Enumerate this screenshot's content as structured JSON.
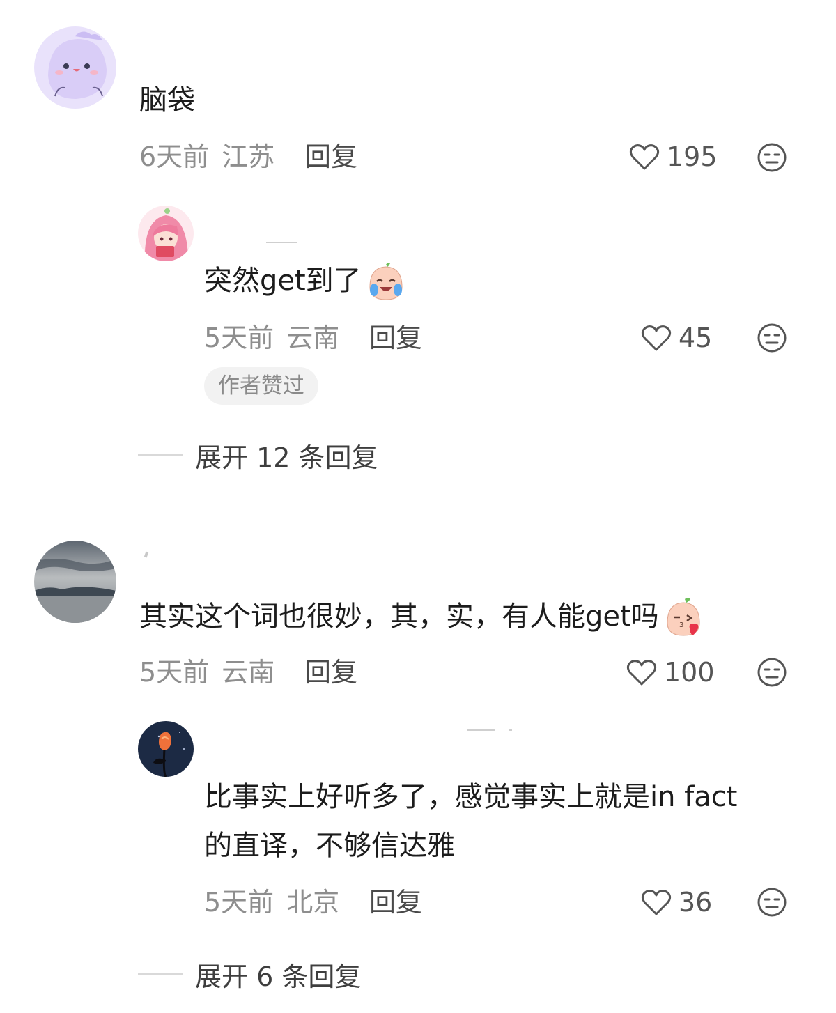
{
  "comments": [
    {
      "text": "脑袋",
      "time": "6天前",
      "location": "江苏",
      "reply_label": "回复",
      "likes": "195",
      "avatar": "purple-cartoon-avatar",
      "replies": [
        {
          "text": "突然get到了",
          "emoji": "crying-laughing-peach-emoji",
          "time": "5天前",
          "location": "云南",
          "reply_label": "回复",
          "likes": "45",
          "badge": "作者赞过",
          "avatar": "pink-anime-girl-avatar"
        }
      ],
      "expand_label": "展开 12 条回复"
    },
    {
      "text": "其实这个词也很妙，其，实，有人能get吗",
      "emoji": "kissing-peach-emoji",
      "time": "5天前",
      "location": "云南",
      "reply_label": "回复",
      "likes": "100",
      "avatar": "cloudy-sea-avatar",
      "replies": [
        {
          "text_line1": "比事实上好听多了，感觉事实上就是in fact",
          "text_line2": "的直译，不够信达雅",
          "time": "5天前",
          "location": "北京",
          "reply_label": "回复",
          "likes": "36",
          "avatar": "night-rose-avatar"
        }
      ],
      "expand_label": "展开 6 条回复"
    }
  ],
  "colors": {
    "text": "#1c1c1c",
    "meta": "#8e8e8e",
    "badge_bg": "#f2f2f2"
  }
}
